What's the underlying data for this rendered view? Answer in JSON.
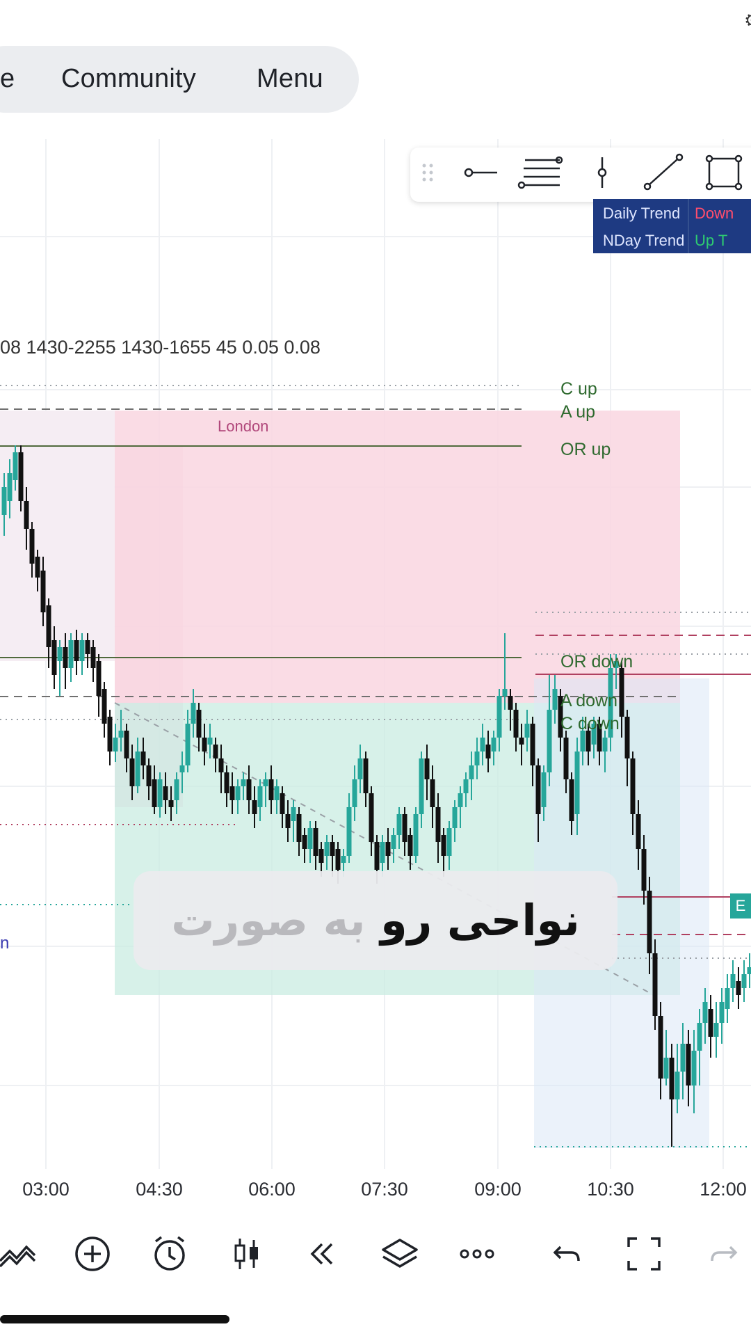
{
  "nav": {
    "partial_label": "e",
    "community_label": "Community",
    "menu_label": "Menu"
  },
  "trend_table": [
    {
      "label": "Daily Trend",
      "value": "Down",
      "value_color": "#ff4d6d"
    },
    {
      "label": "NDay Trend",
      "value": "Up T",
      "value_color": "#2ecc71"
    }
  ],
  "indicator_params": "08 1430-2255 1430-1655 45 0.05 0.08",
  "levels": {
    "c_up": "C up",
    "a_up": "A up",
    "or_up": "OR up",
    "or_down": "OR down",
    "a_down": "A down",
    "c_down": "C down"
  },
  "session_label": "London",
  "partial_left_label": "n",
  "right_edge_badge": "E",
  "caption": {
    "light_part": "به صورت",
    "dark_part": "نواحی رو"
  },
  "time_axis": [
    "03:00",
    "04:30",
    "06:00",
    "07:30",
    "09:00",
    "10:30",
    "12:00"
  ],
  "colors": {
    "bull": "#26a69a",
    "bear": "#111111",
    "session_pink": "#f9d6e0",
    "session_green": "#c9ece1",
    "table_bg": "#1e3a82"
  },
  "drawing_tools": [
    "drag-handle-icon",
    "horizontal-ray-icon",
    "fib-levels-icon",
    "vertical-line-icon",
    "trend-line-icon",
    "rectangle-icon"
  ],
  "bottom_tools": [
    "indicators-icon",
    "add-icon",
    "alert-clock-icon",
    "candles-icon",
    "replay-icon",
    "layers-icon",
    "more-icon",
    "undo-icon",
    "fullscreen-icon",
    "redo-icon"
  ]
}
